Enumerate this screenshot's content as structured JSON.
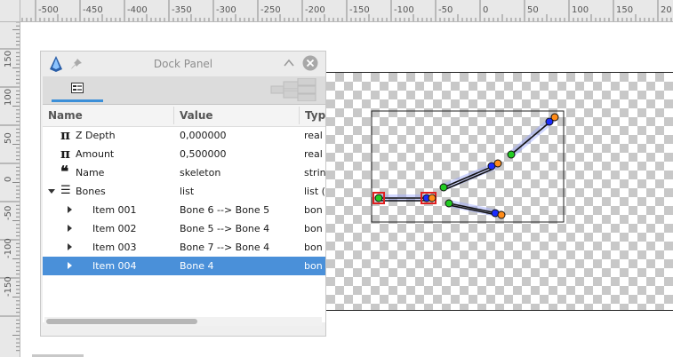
{
  "rulers": {
    "horizontal": [
      "-500",
      "-450",
      "-400",
      "-350",
      "-300",
      "-250",
      "-200",
      "-150",
      "-100",
      "-50",
      "0",
      "50",
      "100",
      "150",
      "20"
    ],
    "vertical": [
      "150",
      "100",
      "50",
      "0",
      "-50",
      "-100",
      "-150"
    ]
  },
  "dock": {
    "title": "Dock Panel",
    "columns": {
      "name": "Name",
      "value": "Value",
      "type": "Typ"
    },
    "rows": [
      {
        "icon": "π",
        "icon_name": "pi-icon",
        "name": "Z Depth",
        "value": "0,000000",
        "type": "real"
      },
      {
        "icon": "π",
        "icon_name": "pi-icon",
        "name": "Amount",
        "value": "0,500000",
        "type": "real"
      },
      {
        "icon": "❝",
        "icon_name": "quote-icon",
        "name": "Name",
        "value": "skeleton",
        "type": "strin"
      },
      {
        "icon": "☰",
        "icon_name": "list-icon",
        "name": "Bones",
        "value": "list",
        "type": "list ("
      },
      {
        "name": "Item 001",
        "value": "Bone 6 --> Bone 5",
        "type": "bon"
      },
      {
        "name": "Item 002",
        "value": "Bone 5 --> Bone 4",
        "type": "bon"
      },
      {
        "name": "Item 003",
        "value": "Bone 7 --> Bone 4",
        "type": "bon"
      },
      {
        "name": "Item 004",
        "value": "Bone 4",
        "type": "bon"
      }
    ]
  },
  "colors": {
    "selection": "#4a90d9",
    "accent": "#3b8fd8",
    "handle_green": "#22cc22",
    "handle_orange": "#ff8c1a",
    "handle_blue": "#1a2cff",
    "handle_red": "#e02020"
  }
}
